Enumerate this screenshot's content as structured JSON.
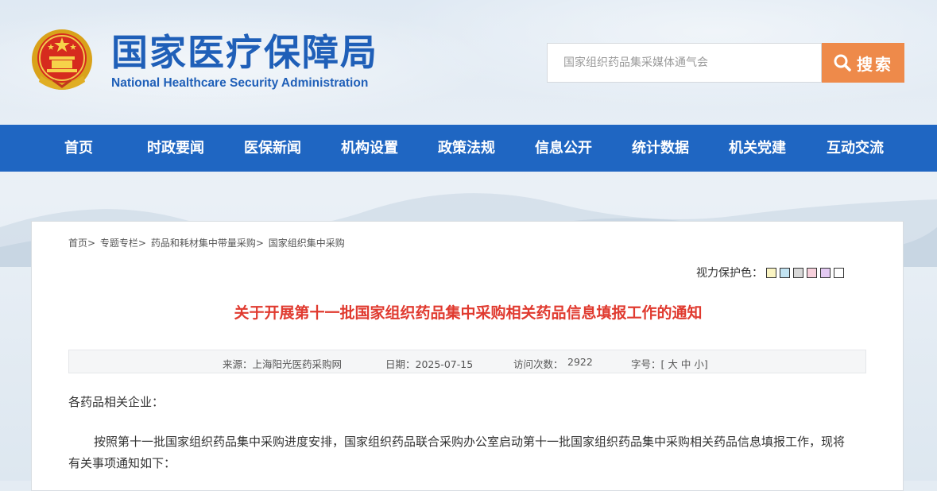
{
  "header": {
    "logo_cn": "国家医疗保障局",
    "logo_en": "National Healthcare Security Administration"
  },
  "search": {
    "placeholder": "国家组织药品集采媒体通气会",
    "button_label": "搜索"
  },
  "nav": {
    "items": [
      {
        "label": "首页"
      },
      {
        "label": "时政要闻"
      },
      {
        "label": "医保新闻"
      },
      {
        "label": "机构设置"
      },
      {
        "label": "政策法规"
      },
      {
        "label": "信息公开"
      },
      {
        "label": "统计数据"
      },
      {
        "label": "机关党建"
      },
      {
        "label": "互动交流"
      }
    ]
  },
  "breadcrumb": {
    "items": [
      "首页",
      "专题专栏",
      "药品和耗材集中带量采购",
      "国家组织集中采购"
    ],
    "separator": ">"
  },
  "eye_care": {
    "label": "视力保护色：",
    "colors": [
      "#faf4c2",
      "#c2e4f3",
      "#d8d8d8",
      "#f7d0dc",
      "#e3c9f2",
      "#ffffff"
    ]
  },
  "article": {
    "title": "关于开展第十一批国家组织药品集中采购相关药品信息填报工作的通知",
    "meta": {
      "source": "来源：上海阳光医药采购网",
      "date": "日期：2025-07-15",
      "visits_label": "访问次数：",
      "visits": "2922",
      "font_size_label": "字号：[",
      "size_large": "大",
      "size_medium": "中",
      "size_small": "小",
      "font_size_end": "]"
    },
    "salutation": "各药品相关企业：",
    "paragraph": "按照第十一批国家组织药品集中采购进度安排，国家组织药品联合采购办公室启动第十一批国家组织药品集中采购相关药品信息填报工作，现将有关事项通知如下："
  }
}
